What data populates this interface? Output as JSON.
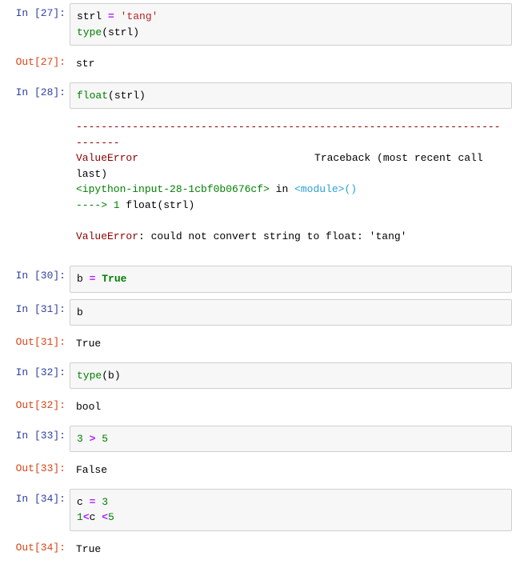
{
  "cells": [
    {
      "in_prompt": "In  [27]:",
      "code": {
        "line1_var": "strl ",
        "line1_op": "=",
        "line1_str": " 'tang'",
        "line2_fn": "type",
        "line2_arg": "(strl)"
      },
      "out_prompt": "Out[27]:",
      "out_text": "str"
    },
    {
      "in_prompt": "In  [28]:",
      "code": {
        "fn": "float",
        "arg": "(strl)"
      },
      "traceback": {
        "hr": "---------------------------------------------------------------------------",
        "errname": "ValueError",
        "tb_label": "Traceback (most recent call last)",
        "file": "<ipython-input-28-1cbf0b0676cf>",
        "in_word": " in ",
        "module": "<module>",
        "parens": "()",
        "arrow": "----> 1 ",
        "call_fn": "float",
        "call_arg": "(strl)",
        "err_final_name": "ValueError",
        "err_final_msg": ": could not convert string to float: 'tang'"
      }
    },
    {
      "in_prompt": "In  [30]:",
      "code": {
        "var": "b ",
        "op": "=",
        "sp": " ",
        "kw": "True"
      }
    },
    {
      "in_prompt": "In  [31]:",
      "code": {
        "txt": "b"
      },
      "out_prompt": "Out[31]:",
      "out_text": "True"
    },
    {
      "in_prompt": "In  [32]:",
      "code": {
        "fn": "type",
        "arg": "(b)"
      },
      "out_prompt": "Out[32]:",
      "out_text": "bool"
    },
    {
      "in_prompt": "In  [33]:",
      "code": {
        "l": "3 ",
        "op": ">",
        "r": " 5"
      },
      "out_prompt": "Out[33]:",
      "out_text": "False"
    },
    {
      "in_prompt": "In  [34]:",
      "code": {
        "line1_var": "c ",
        "line1_op": "=",
        "line1_num": " 3",
        "line2_l": "1",
        "line2_op1": "<",
        "line2_mid": "c ",
        "line2_op2": "<",
        "line2_r": "5"
      },
      "out_prompt": "Out[34]:",
      "out_text": "True"
    }
  ]
}
